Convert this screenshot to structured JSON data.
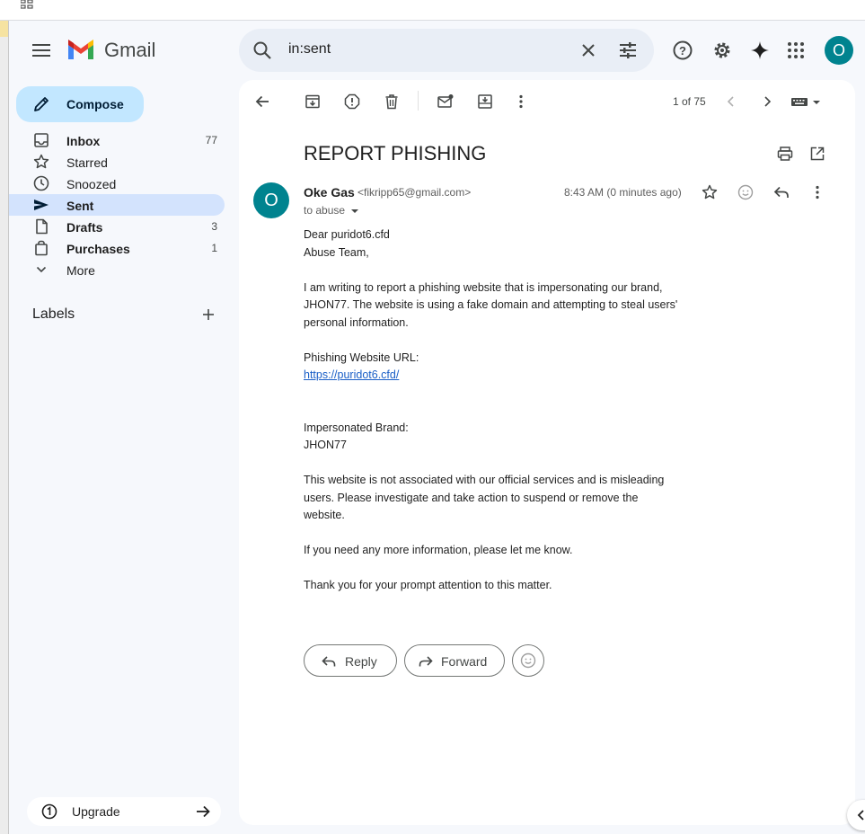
{
  "app": {
    "name": "Gmail",
    "account_initial": "O"
  },
  "search": {
    "query": "in:sent"
  },
  "compose_label": "Compose",
  "nav": [
    {
      "label": "Inbox",
      "count": "77",
      "bold": true,
      "active": false,
      "icon": "inbox-icon"
    },
    {
      "label": "Starred",
      "count": "",
      "bold": false,
      "active": false,
      "icon": "star-icon"
    },
    {
      "label": "Snoozed",
      "count": "",
      "bold": false,
      "active": false,
      "icon": "clock-icon"
    },
    {
      "label": "Sent",
      "count": "",
      "bold": true,
      "active": true,
      "icon": "send-icon"
    },
    {
      "label": "Drafts",
      "count": "3",
      "bold": true,
      "active": false,
      "icon": "draft-icon"
    },
    {
      "label": "Purchases",
      "count": "1",
      "bold": true,
      "active": false,
      "icon": "bag-icon"
    },
    {
      "label": "More",
      "count": "",
      "bold": false,
      "active": false,
      "icon": "chevron-down-icon"
    }
  ],
  "labels_heading": "Labels",
  "upgrade_label": "Upgrade",
  "pager": "1 of 75",
  "message": {
    "subject": "REPORT PHISHING",
    "sender_initial": "O",
    "sender_name": "Oke Gas",
    "sender_email": "<fikripp65@gmail.com>",
    "to": "to abuse",
    "time": "8:43 AM (0 minutes ago)",
    "body": {
      "greeting1": "Dear puridot6.cfd",
      "greeting2": "Abuse Team,",
      "para1": "I am writing to report a phishing website that is impersonating our brand, JHON77. The website is using a fake domain and attempting to steal users' personal information.",
      "url_label": "Phishing Website URL:",
      "url": "https://puridot6.cfd/",
      "brand_label": "Impersonated Brand:",
      "brand": "JHON77",
      "para2": "This website is not associated with our official services and is misleading users. Please investigate and take action to suspend or remove the website.",
      "para3": "If you need any more information, please let me know.",
      "para4": "Thank you for your prompt attention to this matter."
    }
  },
  "actions": {
    "reply": "Reply",
    "forward": "Forward"
  },
  "colors": {
    "accent": "#c2e7ff",
    "active_nav": "#d3e3fd",
    "avatar": "#00838f",
    "link": "#1a5fc7"
  }
}
